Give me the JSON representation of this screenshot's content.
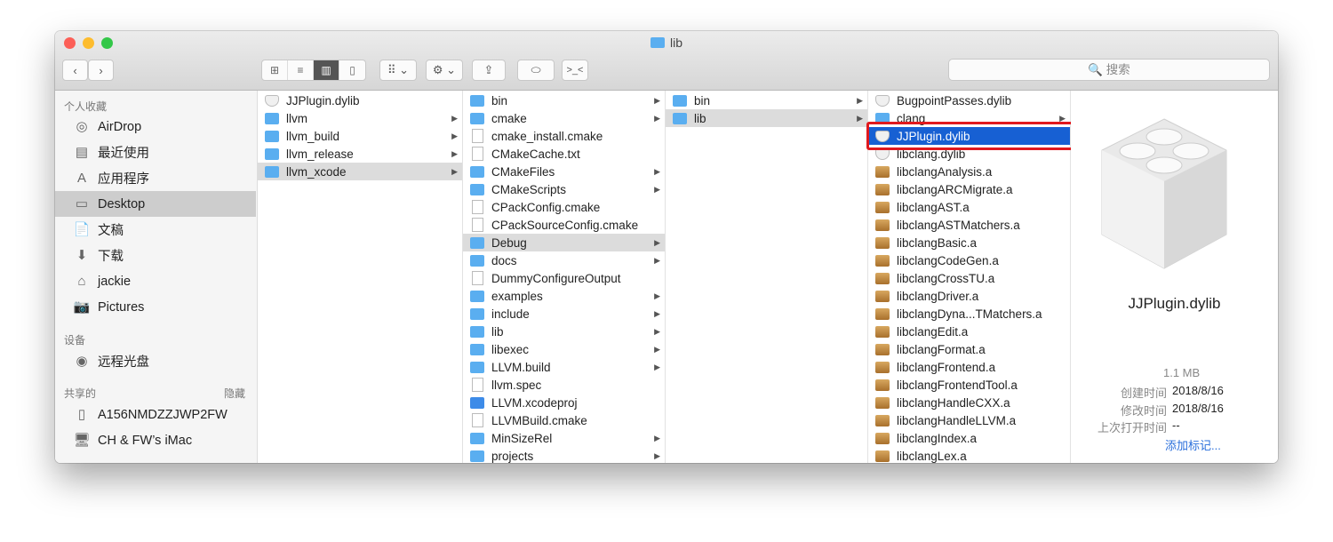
{
  "window": {
    "title": "lib",
    "traffic_colors": [
      "#fc5f57",
      "#fdbc2e",
      "#33c748"
    ]
  },
  "toolbar": {
    "back": "‹",
    "forward": "›",
    "view_icon": "⊞",
    "view_list": "≡",
    "view_column": "▥",
    "view_cover": "▯",
    "arrange": "⠿ ⌄",
    "action": "⚙ ⌄",
    "share": "⇪",
    "tag": "⬭",
    "terminal": ">_<",
    "search_placeholder": "🔍 搜索"
  },
  "sidebar": {
    "favorites_header": "个人收藏",
    "favorites": [
      {
        "label": "AirDrop",
        "icon": "◎"
      },
      {
        "label": "最近使用",
        "icon": "▤"
      },
      {
        "label": "应用程序",
        "icon": "A"
      },
      {
        "label": "Desktop",
        "icon": "▭",
        "selected": true
      },
      {
        "label": "文稿",
        "icon": "📄"
      },
      {
        "label": "下载",
        "icon": "⬇"
      },
      {
        "label": "jackie",
        "icon": "⌂"
      },
      {
        "label": "Pictures",
        "icon": "📷"
      }
    ],
    "devices_header": "设备",
    "devices": [
      {
        "label": "远程光盘",
        "icon": "◉"
      }
    ],
    "shared_header": "共享的",
    "shared_hide": "隐藏",
    "shared": [
      {
        "label": "A156NMDZZJWP2FW",
        "icon": "▯"
      },
      {
        "label": "CH & FW’s iMac",
        "icon": "🖥"
      }
    ]
  },
  "columns": [
    [
      {
        "n": "JJPlugin.dylib",
        "t": "dylib"
      },
      {
        "n": "llvm",
        "t": "folder",
        "a": 1
      },
      {
        "n": "llvm_build",
        "t": "folder",
        "a": 1
      },
      {
        "n": "llvm_release",
        "t": "folder",
        "a": 1
      },
      {
        "n": "llvm_xcode",
        "t": "folder",
        "a": 1,
        "s": "gray"
      }
    ],
    [
      {
        "n": "bin",
        "t": "folder",
        "a": 1
      },
      {
        "n": "cmake",
        "t": "folder",
        "a": 1
      },
      {
        "n": "cmake_install.cmake",
        "t": "file"
      },
      {
        "n": "CMakeCache.txt",
        "t": "file"
      },
      {
        "n": "CMakeFiles",
        "t": "folder",
        "a": 1
      },
      {
        "n": "CMakeScripts",
        "t": "folder",
        "a": 1
      },
      {
        "n": "CPackConfig.cmake",
        "t": "file"
      },
      {
        "n": "CPackSourceConfig.cmake",
        "t": "file"
      },
      {
        "n": "Debug",
        "t": "folder",
        "a": 1,
        "s": "gray"
      },
      {
        "n": "docs",
        "t": "folder",
        "a": 1
      },
      {
        "n": "DummyConfigureOutput",
        "t": "file"
      },
      {
        "n": "examples",
        "t": "folder",
        "a": 1
      },
      {
        "n": "include",
        "t": "folder",
        "a": 1
      },
      {
        "n": "lib",
        "t": "folder",
        "a": 1
      },
      {
        "n": "libexec",
        "t": "folder",
        "a": 1
      },
      {
        "n": "LLVM.build",
        "t": "folder",
        "a": 1
      },
      {
        "n": "llvm.spec",
        "t": "file"
      },
      {
        "n": "LLVM.xcodeproj",
        "t": "xcodeproj"
      },
      {
        "n": "LLVMBuild.cmake",
        "t": "file"
      },
      {
        "n": "MinSizeRel",
        "t": "folder",
        "a": 1
      },
      {
        "n": "projects",
        "t": "folder",
        "a": 1
      }
    ],
    [
      {
        "n": "bin",
        "t": "folder",
        "a": 1
      },
      {
        "n": "lib",
        "t": "folder",
        "a": 1,
        "s": "gray"
      }
    ],
    [
      {
        "n": "BugpointPasses.dylib",
        "t": "dylib"
      },
      {
        "n": "clang",
        "t": "folder",
        "a": 1
      },
      {
        "n": "JJPlugin.dylib",
        "t": "dylib",
        "s": "blue"
      },
      {
        "n": "libclang.dylib",
        "t": "dylib"
      },
      {
        "n": "libclangAnalysis.a",
        "t": "arch"
      },
      {
        "n": "libclangARCMigrate.a",
        "t": "arch"
      },
      {
        "n": "libclangAST.a",
        "t": "arch"
      },
      {
        "n": "libclangASTMatchers.a",
        "t": "arch"
      },
      {
        "n": "libclangBasic.a",
        "t": "arch"
      },
      {
        "n": "libclangCodeGen.a",
        "t": "arch"
      },
      {
        "n": "libclangCrossTU.a",
        "t": "arch"
      },
      {
        "n": "libclangDriver.a",
        "t": "arch"
      },
      {
        "n": "libclangDyna...TMatchers.a",
        "t": "arch"
      },
      {
        "n": "libclangEdit.a",
        "t": "arch"
      },
      {
        "n": "libclangFormat.a",
        "t": "arch"
      },
      {
        "n": "libclangFrontend.a",
        "t": "arch"
      },
      {
        "n": "libclangFrontendTool.a",
        "t": "arch"
      },
      {
        "n": "libclangHandleCXX.a",
        "t": "arch"
      },
      {
        "n": "libclangHandleLLVM.a",
        "t": "arch"
      },
      {
        "n": "libclangIndex.a",
        "t": "arch"
      },
      {
        "n": "libclangLex.a",
        "t": "arch"
      }
    ]
  ],
  "preview": {
    "name": "JJPlugin.dylib",
    "size": "1.1 MB",
    "rows": [
      {
        "k": "创建时间",
        "v": "2018/8/16"
      },
      {
        "k": "修改时间",
        "v": "2018/8/16"
      },
      {
        "k": "上次打开时间",
        "v": "--"
      }
    ],
    "add_tags": "添加标记...",
    "link_color": "#2a6fdb"
  }
}
